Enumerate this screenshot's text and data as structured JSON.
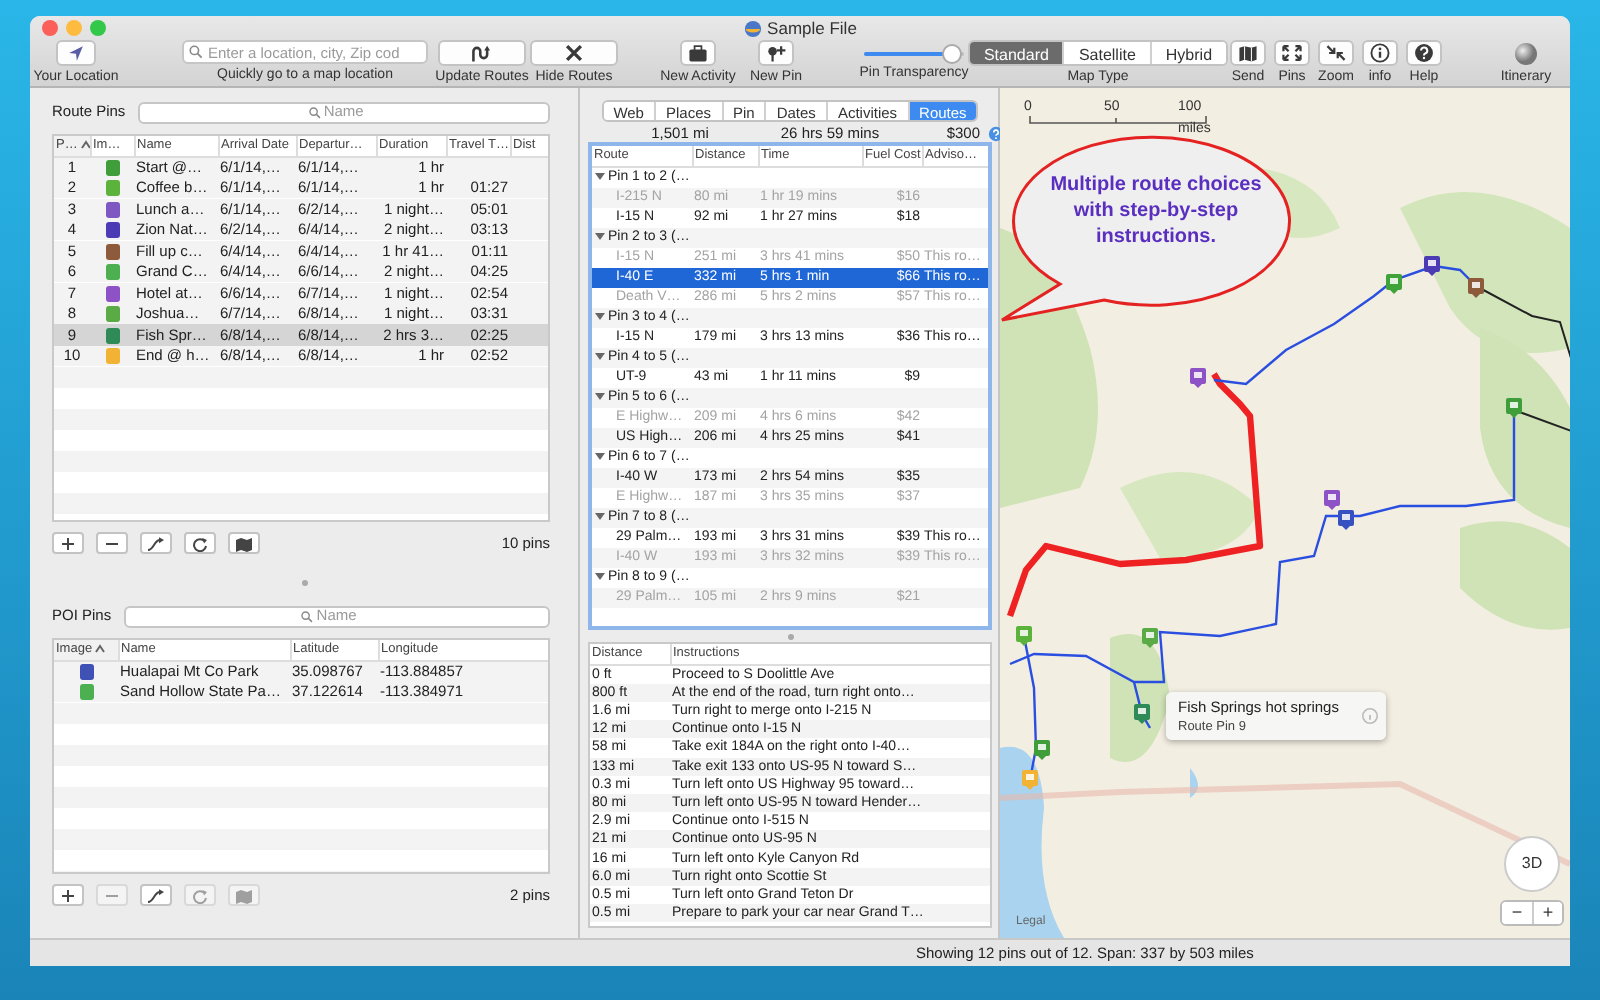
{
  "window": {
    "title": "Sample File"
  },
  "toolbar": {
    "location_button": {
      "label": "Your Location"
    },
    "search": {
      "placeholder": "Enter a location, city, Zip cod",
      "caption": "Quickly go to a map location"
    },
    "route_buttons": [
      {
        "label": "Update Routes"
      },
      {
        "label": "Hide Routes"
      }
    ],
    "add_buttons": [
      {
        "label": "New Activity"
      },
      {
        "label": "New Pin"
      }
    ],
    "pin_transparency": {
      "label": "Pin Transparency",
      "level": 0.88
    },
    "map_type": {
      "label": "Map Type",
      "options": [
        {
          "label": "Standard",
          "selected": true
        },
        {
          "label": "Satellite",
          "selected": false
        },
        {
          "label": "Hybrid",
          "selected": false
        }
      ]
    },
    "tool_buttons": [
      {
        "label": "Send"
      },
      {
        "label": "Pins"
      },
      {
        "label": "Zoom"
      },
      {
        "label": "info"
      },
      {
        "label": "Help"
      }
    ],
    "itinerary_button": {
      "label": "Itinerary"
    }
  },
  "route_pins": {
    "title": "Route Pins",
    "search_placeholder": "Name",
    "columns": [
      {
        "label": "P…",
        "sorted": true
      },
      {
        "label": "Im…",
        "sorted": false
      },
      {
        "label": "Name",
        "sorted": false
      },
      {
        "label": "Arrival Date",
        "sorted": false
      },
      {
        "label": "Departur…",
        "sorted": false
      },
      {
        "label": "Duration",
        "sorted": false
      },
      {
        "label": "Travel T…",
        "sorted": false
      },
      {
        "label": "Dist",
        "sorted": false
      }
    ],
    "rows": [
      {
        "number": "1",
        "color": "#3f9e3a",
        "name": "Start @…",
        "arrival": "6/1/14,…",
        "departure": "6/1/14,…",
        "duration": "1 hr",
        "selected": false
      },
      {
        "number": "2",
        "color": "#5cb33c",
        "name": "Coffee b…",
        "arrival": "6/1/14,…",
        "departure": "6/1/14,…",
        "duration": "1 hr",
        "travel": "01:27",
        "selected": false
      },
      {
        "number": "3",
        "color": "#7e57c2",
        "name": "Lunch a…",
        "arrival": "6/1/14,…",
        "departure": "6/2/14,…",
        "duration": "1 night…",
        "travel": "05:01",
        "selected": false
      },
      {
        "number": "4",
        "color": "#4b3cb5",
        "name": "Zion Nat…",
        "arrival": "6/2/14,…",
        "departure": "6/4/14,…",
        "duration": "2 night…",
        "travel": "03:13",
        "selected": false
      },
      {
        "number": "5",
        "color": "#8d5b3c",
        "name": "Fill up c…",
        "arrival": "6/4/14,…",
        "departure": "6/4/14,…",
        "duration": "1 hr 41…",
        "travel": "01:11",
        "selected": false
      },
      {
        "number": "6",
        "color": "#4caf50",
        "name": "Grand C…",
        "arrival": "6/4/14,…",
        "departure": "6/6/14,…",
        "duration": "2 night…",
        "travel": "04:25",
        "selected": false
      },
      {
        "number": "7",
        "color": "#8e52c7",
        "name": "Hotel at…",
        "arrival": "6/6/14,…",
        "departure": "6/7/14,…",
        "duration": "1 night…",
        "travel": "02:54",
        "selected": false
      },
      {
        "number": "8",
        "color": "#5aab46",
        "name": "Joshua…",
        "arrival": "6/7/14,…",
        "departure": "6/8/14,…",
        "duration": "1 night…",
        "travel": "03:31",
        "selected": false
      },
      {
        "number": "9",
        "color": "#2e8b57",
        "name": "Fish Spr…",
        "arrival": "6/8/14,…",
        "departure": "6/8/14,…",
        "duration": "2 hrs 3…",
        "travel": "02:25",
        "selected": true
      },
      {
        "number": "10",
        "color": "#f2b233",
        "name": "End @ h…",
        "arrival": "6/8/14,…",
        "departure": "6/8/14,…",
        "duration": "1 hr",
        "travel": "02:52",
        "selected": false
      }
    ],
    "buttons": [
      {
        "disabled": false
      },
      {
        "disabled": false
      },
      {
        "disabled": false
      },
      {
        "disabled": false
      },
      {
        "disabled": false
      }
    ],
    "count": "10 pins"
  },
  "poi_pins": {
    "title": "POI Pins",
    "search_placeholder": "Name",
    "columns": [
      {
        "label": "Image",
        "sorted": true
      },
      {
        "label": "Name",
        "sorted": false
      },
      {
        "label": "Latitude",
        "sorted": false
      },
      {
        "label": "Longitude",
        "sorted": false
      }
    ],
    "rows": [
      {
        "color": "#3f51b5",
        "name": "Hualapai Mt Co Park",
        "latitude": "35.098767",
        "longitude": "-113.884857"
      },
      {
        "color": "#4caf50",
        "name": "Sand Hollow State Pa…",
        "latitude": "37.122614",
        "longitude": "-113.384971"
      }
    ],
    "buttons": [
      {
        "disabled": false
      },
      {
        "disabled": true
      },
      {
        "disabled": false
      },
      {
        "disabled": true
      },
      {
        "disabled": true
      }
    ],
    "count": "2 pins"
  },
  "details": {
    "tabs": [
      {
        "label": "Web",
        "selected": false
      },
      {
        "label": "Places",
        "selected": false
      },
      {
        "label": "Pin",
        "selected": false
      },
      {
        "label": "Dates",
        "selected": false
      },
      {
        "label": "Activities",
        "selected": false
      },
      {
        "label": "Routes",
        "selected": true
      }
    ],
    "summary": [
      "1,501 mi",
      "26 hrs 59 mins",
      "$300"
    ],
    "route_table": {
      "columns": [
        "Route",
        "Distance",
        "Time",
        "Fuel Cost",
        "Adviso…"
      ],
      "groups": [
        {
          "label": "Pin 1 to 2 (…",
          "expanded": true,
          "routes": [
            {
              "route": "I-215 N",
              "distance": "80 mi",
              "time": "1 hr 19 mins",
              "fuel": "$16",
              "chosen": false,
              "selected": false
            },
            {
              "route": "I-15 N",
              "distance": "92 mi",
              "time": "1 hr 27 mins",
              "fuel": "$18",
              "chosen": true,
              "selected": false
            }
          ]
        },
        {
          "label": "Pin 2 to 3 (…",
          "expanded": true,
          "routes": [
            {
              "route": "I-15 N",
              "distance": "251 mi",
              "time": "3 hrs 41 mins",
              "fuel": "$50",
              "advisory": "This ro…",
              "chosen": false,
              "selected": false
            },
            {
              "route": "I-40 E",
              "distance": "332 mi",
              "time": "5 hrs 1 min",
              "fuel": "$66",
              "advisory": "This ro…",
              "chosen": true,
              "selected": true
            },
            {
              "route": "Death V…",
              "distance": "286 mi",
              "time": "5 hrs 2 mins",
              "fuel": "$57",
              "advisory": "This ro…",
              "chosen": false,
              "selected": false
            }
          ]
        },
        {
          "label": "Pin 3 to 4 (…",
          "expanded": true,
          "routes": [
            {
              "route": "I-15 N",
              "distance": "179 mi",
              "time": "3 hrs 13 mins",
              "fuel": "$36",
              "advisory": "This ro…",
              "chosen": true,
              "selected": false
            }
          ]
        },
        {
          "label": "Pin 4 to 5 (…",
          "expanded": true,
          "routes": [
            {
              "route": "UT-9",
              "distance": "43 mi",
              "time": "1 hr 11 mins",
              "fuel": "$9",
              "chosen": true,
              "selected": false
            }
          ]
        },
        {
          "label": "Pin 5 to 6 (…",
          "expanded": true,
          "routes": [
            {
              "route": "E Highw…",
              "distance": "209 mi",
              "time": "4 hrs 6 mins",
              "fuel": "$42",
              "chosen": false,
              "selected": false
            },
            {
              "route": "US High…",
              "distance": "206 mi",
              "time": "4 hrs 25 mins",
              "fuel": "$41",
              "chosen": true,
              "selected": false
            }
          ]
        },
        {
          "label": "Pin 6 to 7 (…",
          "expanded": true,
          "routes": [
            {
              "route": "I-40 W",
              "distance": "173 mi",
              "time": "2 hrs 54 mins",
              "fuel": "$35",
              "chosen": true,
              "selected": false
            },
            {
              "route": "E Highw…",
              "distance": "187 mi",
              "time": "3 hrs 35 mins",
              "fuel": "$37",
              "chosen": false,
              "selected": false
            }
          ]
        },
        {
          "label": "Pin 7 to 8 (…",
          "expanded": true,
          "routes": [
            {
              "route": "29 Palm…",
              "distance": "193 mi",
              "time": "3 hrs 31 mins",
              "fuel": "$39",
              "advisory": "This ro…",
              "chosen": true,
              "selected": false
            },
            {
              "route": "I-40 W",
              "distance": "193 mi",
              "time": "3 hrs 32 mins",
              "fuel": "$39",
              "advisory": "This ro…",
              "chosen": false,
              "selected": false
            }
          ]
        },
        {
          "label": "Pin 8 to 9 (…",
          "expanded": true,
          "routes": [
            {
              "route": "29 Palm…",
              "distance": "105 mi",
              "time": "2 hrs 9 mins",
              "fuel": "$21",
              "chosen": false,
              "selected": false
            }
          ]
        }
      ]
    },
    "directions": {
      "columns": [
        "Distance",
        "Instructions"
      ],
      "rows": [
        {
          "distance": "0 ft",
          "instruction": "Proceed to S Doolittle Ave"
        },
        {
          "distance": "800 ft",
          "instruction": "At the end of the road, turn right onto…"
        },
        {
          "distance": "1.6 mi",
          "instruction": "Turn right to merge onto I-215 N"
        },
        {
          "distance": "12 mi",
          "instruction": "Continue onto I-15 N"
        },
        {
          "distance": "58 mi",
          "instruction": "Take exit 184A on the right onto I-40…"
        },
        {
          "distance": "133 mi",
          "instruction": "Take exit 133 onto US-95 N toward S…"
        },
        {
          "distance": "0.3 mi",
          "instruction": "Turn left onto US Highway 95 toward…"
        },
        {
          "distance": "80 mi",
          "instruction": "Turn left onto US-95 N toward Hender…"
        },
        {
          "distance": "2.9 mi",
          "instruction": "Continue onto I-515 N"
        },
        {
          "distance": "21 mi",
          "instruction": "Continue onto US-95 N"
        },
        {
          "distance": "16 mi",
          "instruction": "Turn left onto Kyle Canyon Rd"
        },
        {
          "distance": "6.0 mi",
          "instruction": "Turn right onto Scottie St"
        },
        {
          "distance": "0.5 mi",
          "instruction": "Turn left onto Grand Teton Dr"
        },
        {
          "distance": "0.5 mi",
          "instruction": "Prepare to park your car near Grand T…"
        }
      ]
    }
  },
  "map": {
    "scale": [
      "0",
      "50",
      "100 miles"
    ],
    "callout": "Multiple route choices with step-by-step instructions.",
    "popup": {
      "title": "Fish Springs hot springs",
      "subtitle": "Route Pin 9"
    },
    "compass_label": "3D",
    "zoom_buttons": [
      "−",
      "+"
    ],
    "legal": "Legal"
  },
  "status_bar": "Showing 12 pins out of 12. Span: 337 by 503 miles"
}
